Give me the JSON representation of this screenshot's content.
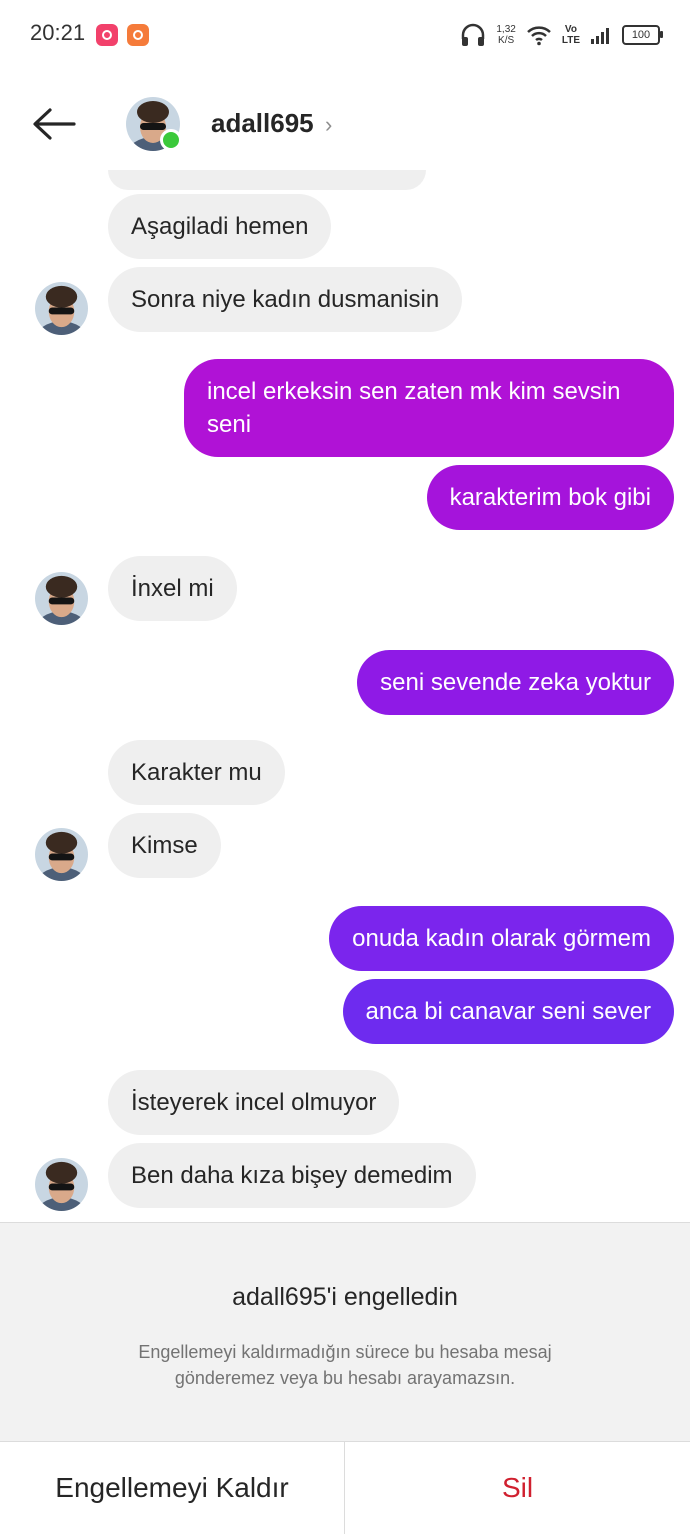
{
  "status_bar": {
    "time": "20:21",
    "net_speed_value": "1,32",
    "net_speed_unit": "K/S",
    "volte_top": "Vo",
    "volte_bottom": "LTE",
    "battery": "100"
  },
  "header": {
    "username": "adall695",
    "online_color": "#3bc93b"
  },
  "messages": [
    {
      "side": "in",
      "text": "Aşagiladi hemen"
    },
    {
      "side": "in",
      "text": "Sonra niye kadın dusmanisin"
    },
    {
      "side": "out",
      "text": "incel erkeksin sen zaten mk kim sevsin seni"
    },
    {
      "side": "out",
      "text": "karakterim bok gibi"
    },
    {
      "side": "in",
      "text": "İnxel mi"
    },
    {
      "side": "out",
      "text": "seni sevende zeka yoktur"
    },
    {
      "side": "in",
      "text": "Karakter mu"
    },
    {
      "side": "in",
      "text": "Kimse"
    },
    {
      "side": "out",
      "text": "onuda kadın olarak görmem"
    },
    {
      "side": "out",
      "text": "anca bi canavar seni sever"
    },
    {
      "side": "in",
      "text": "İsteyerek incel olmuyor"
    },
    {
      "side": "in",
      "text": "Ben daha kıza bişey demedim"
    }
  ],
  "colors": {
    "incoming_bubble": "#efefef",
    "out_1": "#b012d6",
    "out_2": "#a514db",
    "out_3": "#8f1ae6",
    "out_4": "#7b25ed",
    "out_5": "#6e2bef",
    "delete": "#d0202f"
  },
  "blocked": {
    "title": "adall695'i engelledin",
    "description": "Engellemeyi kaldırmadığın sürece bu hesaba mesaj gönderemez veya bu hesabı arayamazsın."
  },
  "actions": {
    "unblock": "Engellemeyi Kaldır",
    "delete": "Sil"
  }
}
